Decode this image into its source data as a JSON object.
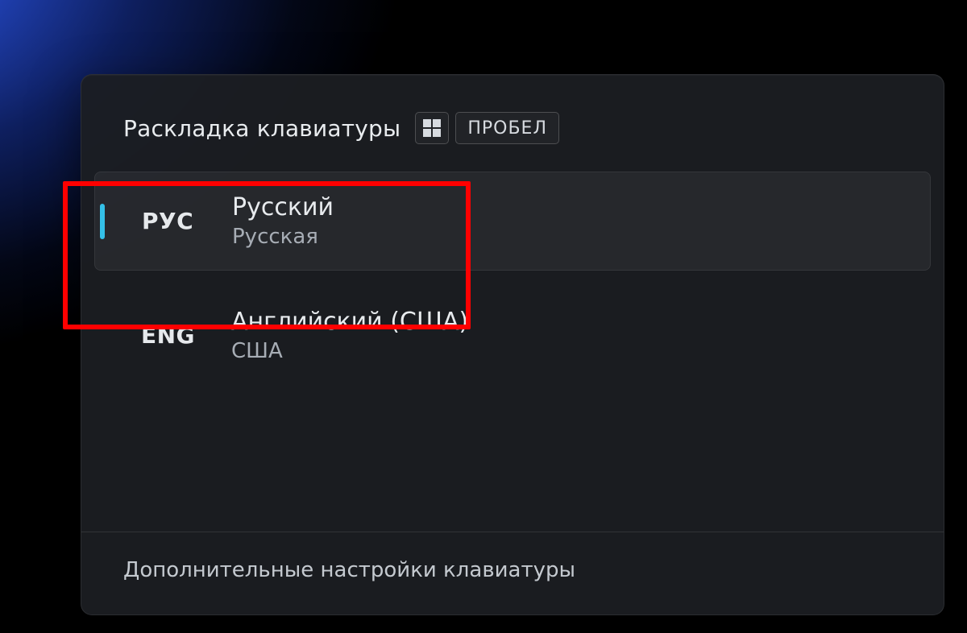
{
  "header": {
    "title": "Раскладка клавиатуры",
    "shortcut_key_label": "ПРОБЕЛ"
  },
  "layouts": [
    {
      "code": "РУС",
      "title": "Русский",
      "subtitle": "Русская",
      "selected": true
    },
    {
      "code": "ENG",
      "title": "Английский (США)",
      "subtitle": "США",
      "selected": false
    }
  ],
  "footer": {
    "more_settings_label": "Дополнительные настройки клавиатуры"
  },
  "colors": {
    "accent": "#34c0e8",
    "highlight": "#ff0000"
  }
}
